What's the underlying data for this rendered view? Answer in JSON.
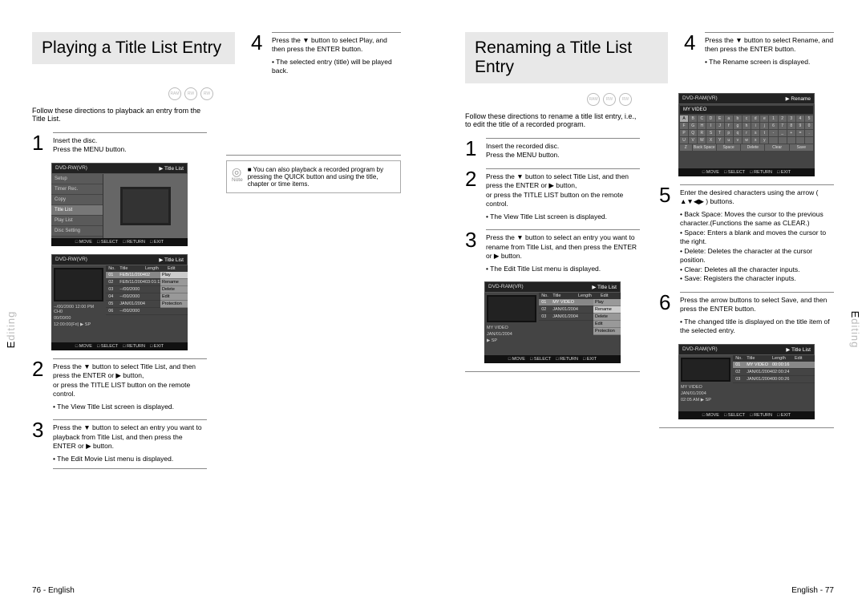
{
  "left": {
    "title": "Playing a Title List Entry",
    "intro": "Follow these directions to playback an entry from the Title List.",
    "side_letter": "E",
    "side_rest": "diting",
    "footer": "76 - English",
    "step1": {
      "l1": "Insert the disc.",
      "l2": "Press the MENU button."
    },
    "step2": {
      "l1": "Press the ▼ button to select Title List, and then press the ENTER or ▶ button,",
      "l2": "or press the TITLE LIST button on the remote control.",
      "res": "• The View Title List screen is displayed."
    },
    "step3": {
      "l1": "Press the ▼ button to select an entry you want to playback from Title List, and then press the ENTER or ▶ button.",
      "res": "• The Edit Movie List menu is displayed."
    },
    "step4": {
      "l1": "Press the ▼ button to select Play, and then press the ENTER button.",
      "res": "• The selected entry (title) will be played back."
    },
    "note": "■ You can also playback a recorded program by pressing the QUICK button and using the title, chapter or time items.",
    "note_lbl": "Note",
    "osd_menu": {
      "hdr_l": "DVD-RW(VR)",
      "hdr_r": "Title List",
      "items": [
        "Setup",
        "Timer Rec.",
        "Copy",
        "Title List",
        "Play List",
        "Disc Setting"
      ],
      "bar": [
        "MOVE",
        "SELECT",
        "RETURN",
        "EXIT"
      ]
    },
    "osd_tl": {
      "hdr_l": "DVD-RW(VR)",
      "hdr_r": "Title List",
      "cols": [
        "No.",
        "Title",
        "Length",
        "Edit"
      ],
      "rows": [
        {
          "n": "01",
          "t": "FEB/11/2004",
          "l": "02",
          "hi": true
        },
        {
          "n": "02",
          "t": "FEB/11/2004",
          "l": "03:01:11"
        },
        {
          "n": "03",
          "t": "--/00/2000",
          "l": ""
        },
        {
          "n": "04",
          "t": "--/00/2000",
          "l": ""
        },
        {
          "n": "05",
          "t": "JAN/01/2004",
          "l": ""
        },
        {
          "n": "06",
          "t": "--/00/2000",
          "l": ""
        }
      ],
      "ctx": [
        "Play",
        "Rename",
        "Delete",
        "Edit",
        "Protection"
      ],
      "meta1": "--/00/2000 12:00 PM CH0",
      "meta2": "00/00/00",
      "meta3": "12:00:00(Fri)      ▶ SP",
      "bar": [
        "MOVE",
        "SELECT",
        "RETURN",
        "EXIT"
      ]
    }
  },
  "right": {
    "title": "Renaming a Title List Entry",
    "intro": "Follow these directions to rename a title list entry, i.e., to edit the title of a recorded program.",
    "side_letter": "E",
    "side_rest": "diting",
    "footer": "English - 77",
    "step1": {
      "l1": "Insert the recorded disc.",
      "l2": "Press the MENU button."
    },
    "step2": {
      "l1": "Press the ▼ button to select Title List, and then press the ENTER or ▶ button,",
      "l2": "or press the TITLE LIST button on the remote control.",
      "res": "• The View Title List screen is displayed."
    },
    "step3": {
      "l1": "Press the ▼ button to select an entry you want to rename from Title List, and then press the ENTER or ▶ button.",
      "res": "• The Edit Title List menu is displayed."
    },
    "step4": {
      "l1": "Press the ▼ button to select Rename, and then press the ENTER button.",
      "res": "• The Rename screen is displayed."
    },
    "step5": {
      "l1": "Enter the desired characters using the arrow ( ▲▼◀▶ ) buttons.",
      "b1": "• Back Space: Moves the cursor to the previous character.(Functions the same as CLEAR.)",
      "b2": "• Space: Enters a blank and moves the cursor to the right.",
      "b3": "• Delete: Deletes the character at the cursor position.",
      "b4": "• Clear: Deletes all the character inputs.",
      "b5": "• Save: Registers the character inputs."
    },
    "step6": {
      "l1": "Press the arrow buttons to select Save, and then press the ENTER button.",
      "res": "• The changed title is displayed on the title item of the selected entry."
    },
    "osd_edit": {
      "hdr_l": "DVD-RAM(VR)",
      "hdr_r": "Title List",
      "cols": [
        "No.",
        "Title",
        "Length",
        "Edit"
      ],
      "rows": [
        {
          "n": "01",
          "t": "MY VIDEO",
          "l": "",
          "hi": true
        },
        {
          "n": "02",
          "t": "JAN/01/2004",
          "l": ""
        },
        {
          "n": "03",
          "t": "JAN/01/2004",
          "l": ""
        }
      ],
      "ctx": [
        "Play",
        "Rename",
        "Delete",
        "Edit",
        "Protection"
      ],
      "meta1": "MY VIDEO",
      "meta2": "JAN/01/2004",
      "meta3": "                  ▶ SP",
      "bar": [
        "MOVE",
        "SELECT",
        "RETURN",
        "EXIT"
      ]
    },
    "osd_kb": {
      "hdr_l": "DVD-RAM(VR)",
      "hdr_r": "Rename",
      "label": "MY VIDEO",
      "rows": [
        [
          "A",
          "B",
          "C",
          "D",
          "E",
          "a",
          "b",
          "c",
          "d",
          "e",
          "1",
          "2",
          "3",
          "4",
          "5"
        ],
        [
          "F",
          "G",
          "H",
          "I",
          "J",
          "f",
          "g",
          "h",
          "i",
          "j",
          "6",
          "7",
          "8",
          "9",
          "0"
        ],
        [
          "K",
          "L",
          "M",
          "N",
          "O",
          "k",
          "l",
          "m",
          "n",
          "o",
          "-",
          "_",
          "+",
          "=",
          "."
        ],
        [
          "P",
          "Q",
          "R",
          "S",
          "T",
          "p",
          "q",
          "r",
          "s",
          "t",
          "",
          "",
          "",
          "",
          ""
        ],
        [
          "U",
          "V",
          "W",
          "X",
          "Y",
          "u",
          "v",
          "w",
          "x",
          "y",
          "",
          "",
          "",
          "",
          ""
        ]
      ],
      "bottom": [
        "Z",
        "Back Space",
        "Space",
        "Delete",
        "Clear",
        "Save"
      ],
      "bar": [
        "MOVE",
        "SELECT",
        "RETURN",
        "EXIT"
      ]
    },
    "osd_final": {
      "hdr_l": "DVD-RAM(VR)",
      "hdr_r": "Title List",
      "cols": [
        "No.",
        "Title",
        "Length",
        "Edit"
      ],
      "rows": [
        {
          "n": "01",
          "t": "MY VIDEO",
          "l": "00:00:16",
          "hi": true
        },
        {
          "n": "02",
          "t": "JAN/01/2004",
          "l": "02:00:24"
        },
        {
          "n": "03",
          "t": "JAN/01/2004",
          "l": "00:00:26"
        }
      ],
      "meta1": "MY VIDEO",
      "meta2": "JAN/01/2004",
      "meta3": "02:05 AM          ▶ SP",
      "bar": [
        "MOVE",
        "SELECT",
        "RETURN",
        "EXIT"
      ]
    }
  }
}
